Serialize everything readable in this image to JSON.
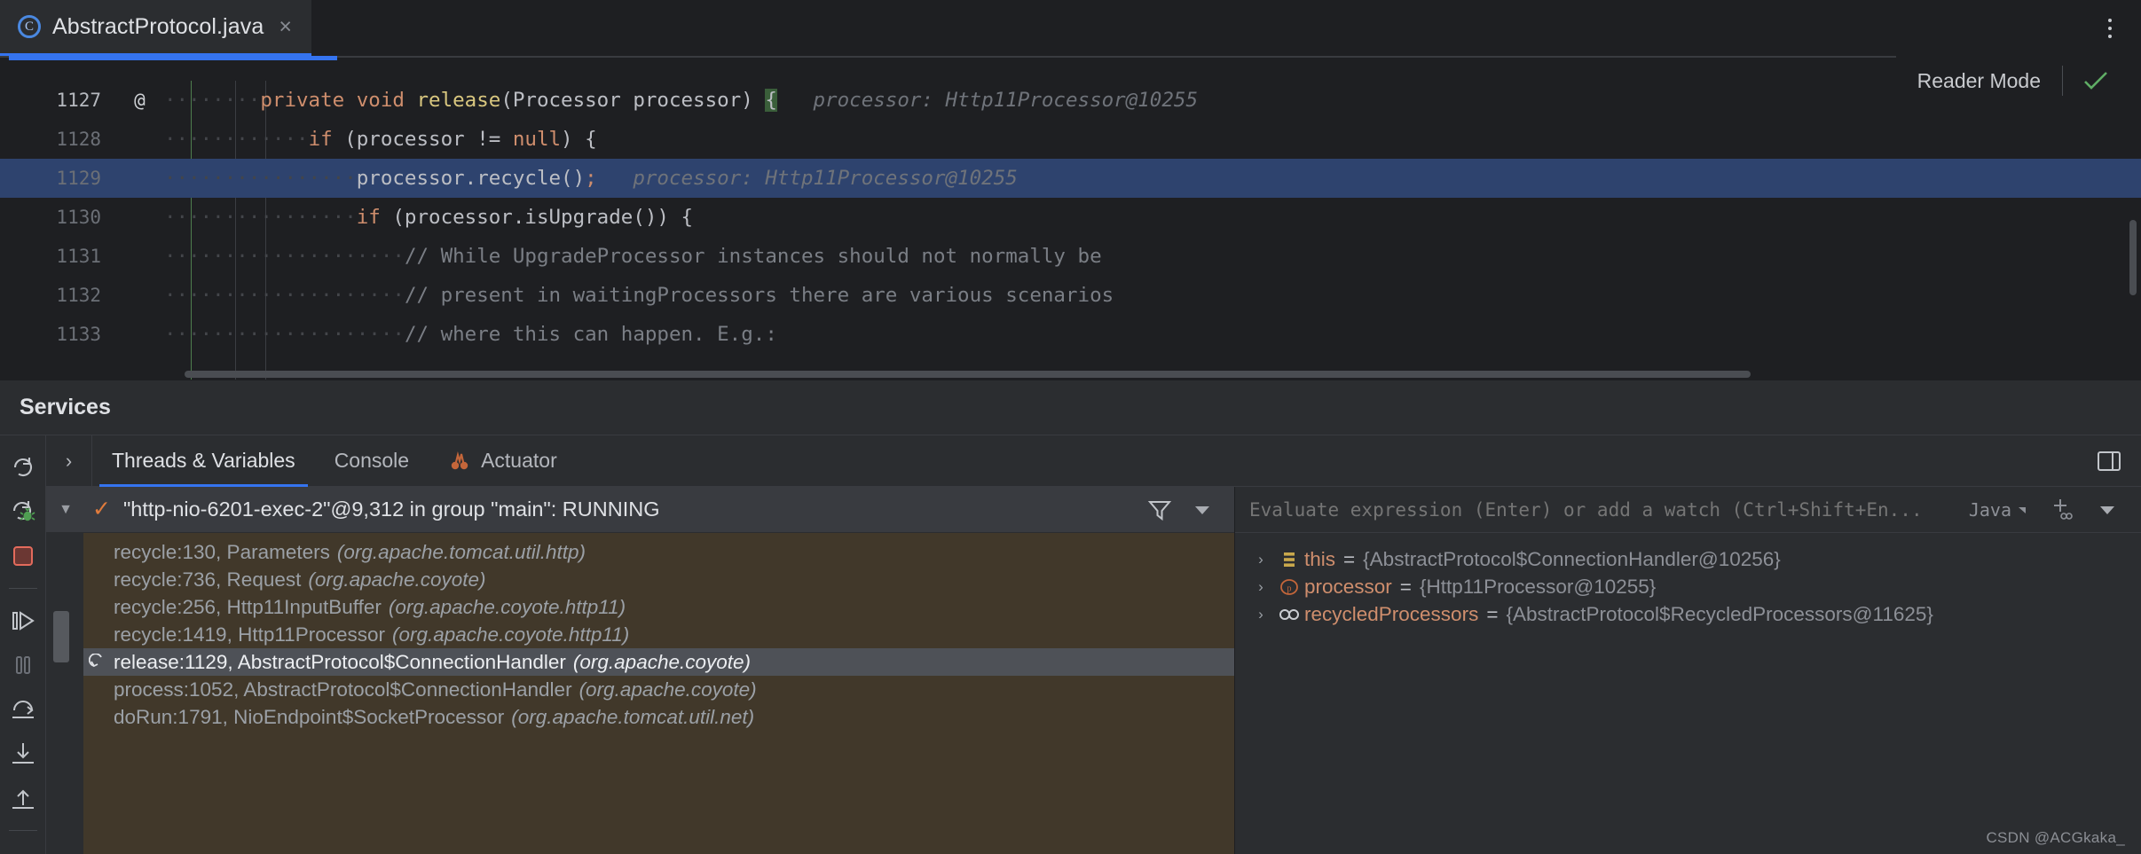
{
  "editor": {
    "tab": {
      "title": "AbstractProtocol.java",
      "icon": "java-class-icon",
      "close": "×"
    },
    "reader_mode": {
      "label": "Reader Mode",
      "check": "✓"
    },
    "lines": [
      {
        "number": "1127",
        "marker": "@",
        "indent": "········",
        "segments": [
          {
            "cls": "kw",
            "text": "private "
          },
          {
            "cls": "kw",
            "text": "void "
          },
          {
            "cls": "meth",
            "text": "release"
          },
          {
            "cls": "plain",
            "text": "(Processor processor) "
          },
          {
            "cls": "brace-hl",
            "text": "{"
          }
        ],
        "hint": "processor: Http11Processor@10255",
        "highlight": false
      },
      {
        "number": "1128",
        "marker": "",
        "indent": "············",
        "segments": [
          {
            "cls": "kw",
            "text": "if "
          },
          {
            "cls": "plain",
            "text": "(processor != "
          },
          {
            "cls": "kw",
            "text": "null"
          },
          {
            "cls": "plain",
            "text": ") {"
          }
        ],
        "hint": "",
        "highlight": false
      },
      {
        "number": "1129",
        "marker": "",
        "indent": "················",
        "segments": [
          {
            "cls": "plain",
            "text": "processor.recycle()"
          },
          {
            "cls": "semi",
            "text": ";"
          }
        ],
        "hint": "processor: Http11Processor@10255",
        "highlight": true
      },
      {
        "number": "1130",
        "marker": "",
        "indent": "················",
        "segments": [
          {
            "cls": "kw",
            "text": "if "
          },
          {
            "cls": "plain",
            "text": "(processor.isUpgrade()) {"
          }
        ],
        "hint": "",
        "highlight": false
      },
      {
        "number": "1131",
        "marker": "",
        "indent": "····················",
        "segments": [
          {
            "cls": "cmt",
            "text": "// While UpgradeProcessor instances should not normally be"
          }
        ],
        "hint": "",
        "highlight": false
      },
      {
        "number": "1132",
        "marker": "",
        "indent": "····················",
        "segments": [
          {
            "cls": "cmt",
            "text": "// present in waitingProcessors there are various scenarios"
          }
        ],
        "hint": "",
        "highlight": false
      },
      {
        "number": "1133",
        "marker": "",
        "indent": "····················",
        "segments": [
          {
            "cls": "cmt",
            "text": "// where this can happen. E.g.:"
          }
        ],
        "hint": "",
        "highlight": false
      }
    ]
  },
  "services": {
    "title": "Services",
    "tabs": [
      {
        "label": "Threads & Variables",
        "icon": "",
        "active": true
      },
      {
        "label": "Console",
        "icon": "",
        "active": false
      },
      {
        "label": "Actuator",
        "icon": "actuator-icon",
        "active": false
      }
    ],
    "toolbar": [
      {
        "name": "rerun-icon"
      },
      {
        "name": "rerun-debug-icon"
      },
      {
        "name": "stop-icon"
      },
      {
        "name": "resume-program-icon"
      },
      {
        "name": "pause-program-icon"
      },
      {
        "name": "step-over-icon"
      },
      {
        "name": "step-into-icon"
      },
      {
        "name": "step-out-icon"
      }
    ],
    "thread": {
      "label": "\"http-nio-6201-exec-2\"@9,312 in group \"main\": RUNNING",
      "status_icon": "running-check-icon",
      "filter_icon": "filter-icon",
      "dropdown_icon": "chevron-down-icon"
    },
    "frames": [
      {
        "method": "recycle:130, Parameters",
        "pkg": "(org.apache.tomcat.util.http)",
        "selected": false
      },
      {
        "method": "recycle:736, Request",
        "pkg": "(org.apache.coyote)",
        "selected": false
      },
      {
        "method": "recycle:256, Http11InputBuffer",
        "pkg": "(org.apache.coyote.http11)",
        "selected": false
      },
      {
        "method": "recycle:1419, Http11Processor",
        "pkg": "(org.apache.coyote.http11)",
        "selected": false
      },
      {
        "method": "release:1129, AbstractProtocol$ConnectionHandler",
        "pkg": "(org.apache.coyote)",
        "selected": true
      },
      {
        "method": "process:1052, AbstractProtocol$ConnectionHandler",
        "pkg": "(org.apache.coyote)",
        "selected": false
      },
      {
        "method": "doRun:1791, NioEndpoint$SocketProcessor",
        "pkg": "(org.apache.tomcat.util.net)",
        "selected": false
      }
    ],
    "evaluate": {
      "placeholder": "Evaluate expression (Enter) or add a watch (Ctrl+Shift+En...",
      "value": "",
      "language": "Java",
      "add_watch_icon": "add-watch-icon",
      "more_icon": "chevron-down-icon"
    },
    "variables": [
      {
        "icon": "field-icon",
        "name": "this",
        "value": "{AbstractProtocol$ConnectionHandler@10256}"
      },
      {
        "icon": "parameter-icon",
        "name": "processor",
        "value": "{Http11Processor@10255}"
      },
      {
        "icon": "watch-icon",
        "name": "recycledProcessors",
        "value": "{AbstractProtocol$RecycledProcessors@11625}"
      }
    ]
  },
  "watermark": "CSDN @ACGkaka_",
  "colors": {
    "accent": "#3574f0",
    "keyword": "#cf8e6d",
    "method": "#d9c77f",
    "comment": "#7a7e85",
    "frames_bg": "#41382a",
    "highlight_line": "#2e436e",
    "running": "#e07b3c"
  }
}
